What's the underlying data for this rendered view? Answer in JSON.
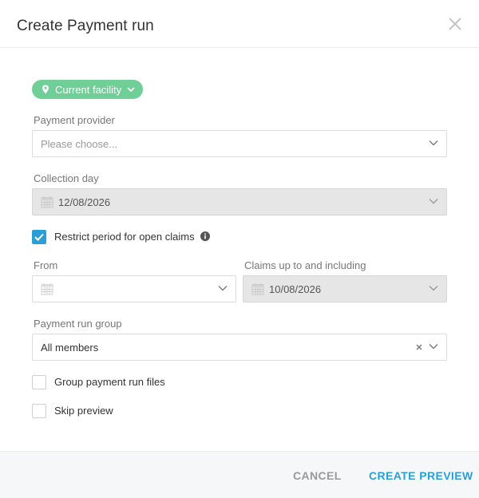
{
  "dialog": {
    "title": "Create Payment run"
  },
  "facility_chip": {
    "label": "Current facility"
  },
  "payment_provider": {
    "label": "Payment provider",
    "placeholder": "Please choose..."
  },
  "collection_day": {
    "label": "Collection day",
    "value": "12/08/2026"
  },
  "restrict_period": {
    "label": "Restrict period for open claims",
    "checked": true
  },
  "from": {
    "label": "From",
    "value": ""
  },
  "claims_up_to": {
    "label": "Claims up to and including",
    "value": "10/08/2026"
  },
  "payment_run_group": {
    "label": "Payment run group",
    "value": "All members"
  },
  "group_files": {
    "label": "Group payment run files",
    "checked": false
  },
  "skip_preview": {
    "label": "Skip preview",
    "checked": false
  },
  "footer": {
    "cancel_label": "CANCEL",
    "create_label": "CREATE PREVIEW"
  },
  "colors": {
    "accent": "#2a9fd6",
    "chip": "#6fcf97",
    "disabled_field": "#e6e6e6"
  },
  "icons": [
    "close-icon",
    "location-pin-icon",
    "chevron-down-icon",
    "calendar-icon",
    "info-icon",
    "checkmark-icon",
    "clear-icon"
  ]
}
